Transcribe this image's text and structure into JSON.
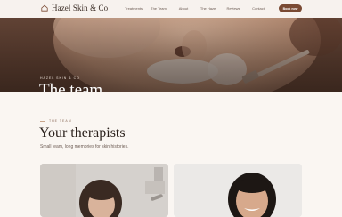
{
  "brand": {
    "name": "Hazel Skin & Co",
    "icon": "house-icon"
  },
  "nav": {
    "links": [
      "Treatments",
      "The Team",
      "About",
      "The Hazel",
      "Reviews",
      "Contact"
    ],
    "book_label": "Book now"
  },
  "hero": {
    "eyebrow": "HAZEL SKIN & CO",
    "title": "The team"
  },
  "section": {
    "eyebrow": "THE TEAM",
    "title": "Your therapists",
    "subtitle": "Small team, long memories for skin histories."
  },
  "colors": {
    "accent": "#7a4a33",
    "background": "#faf6f2",
    "text": "#2b211c"
  }
}
